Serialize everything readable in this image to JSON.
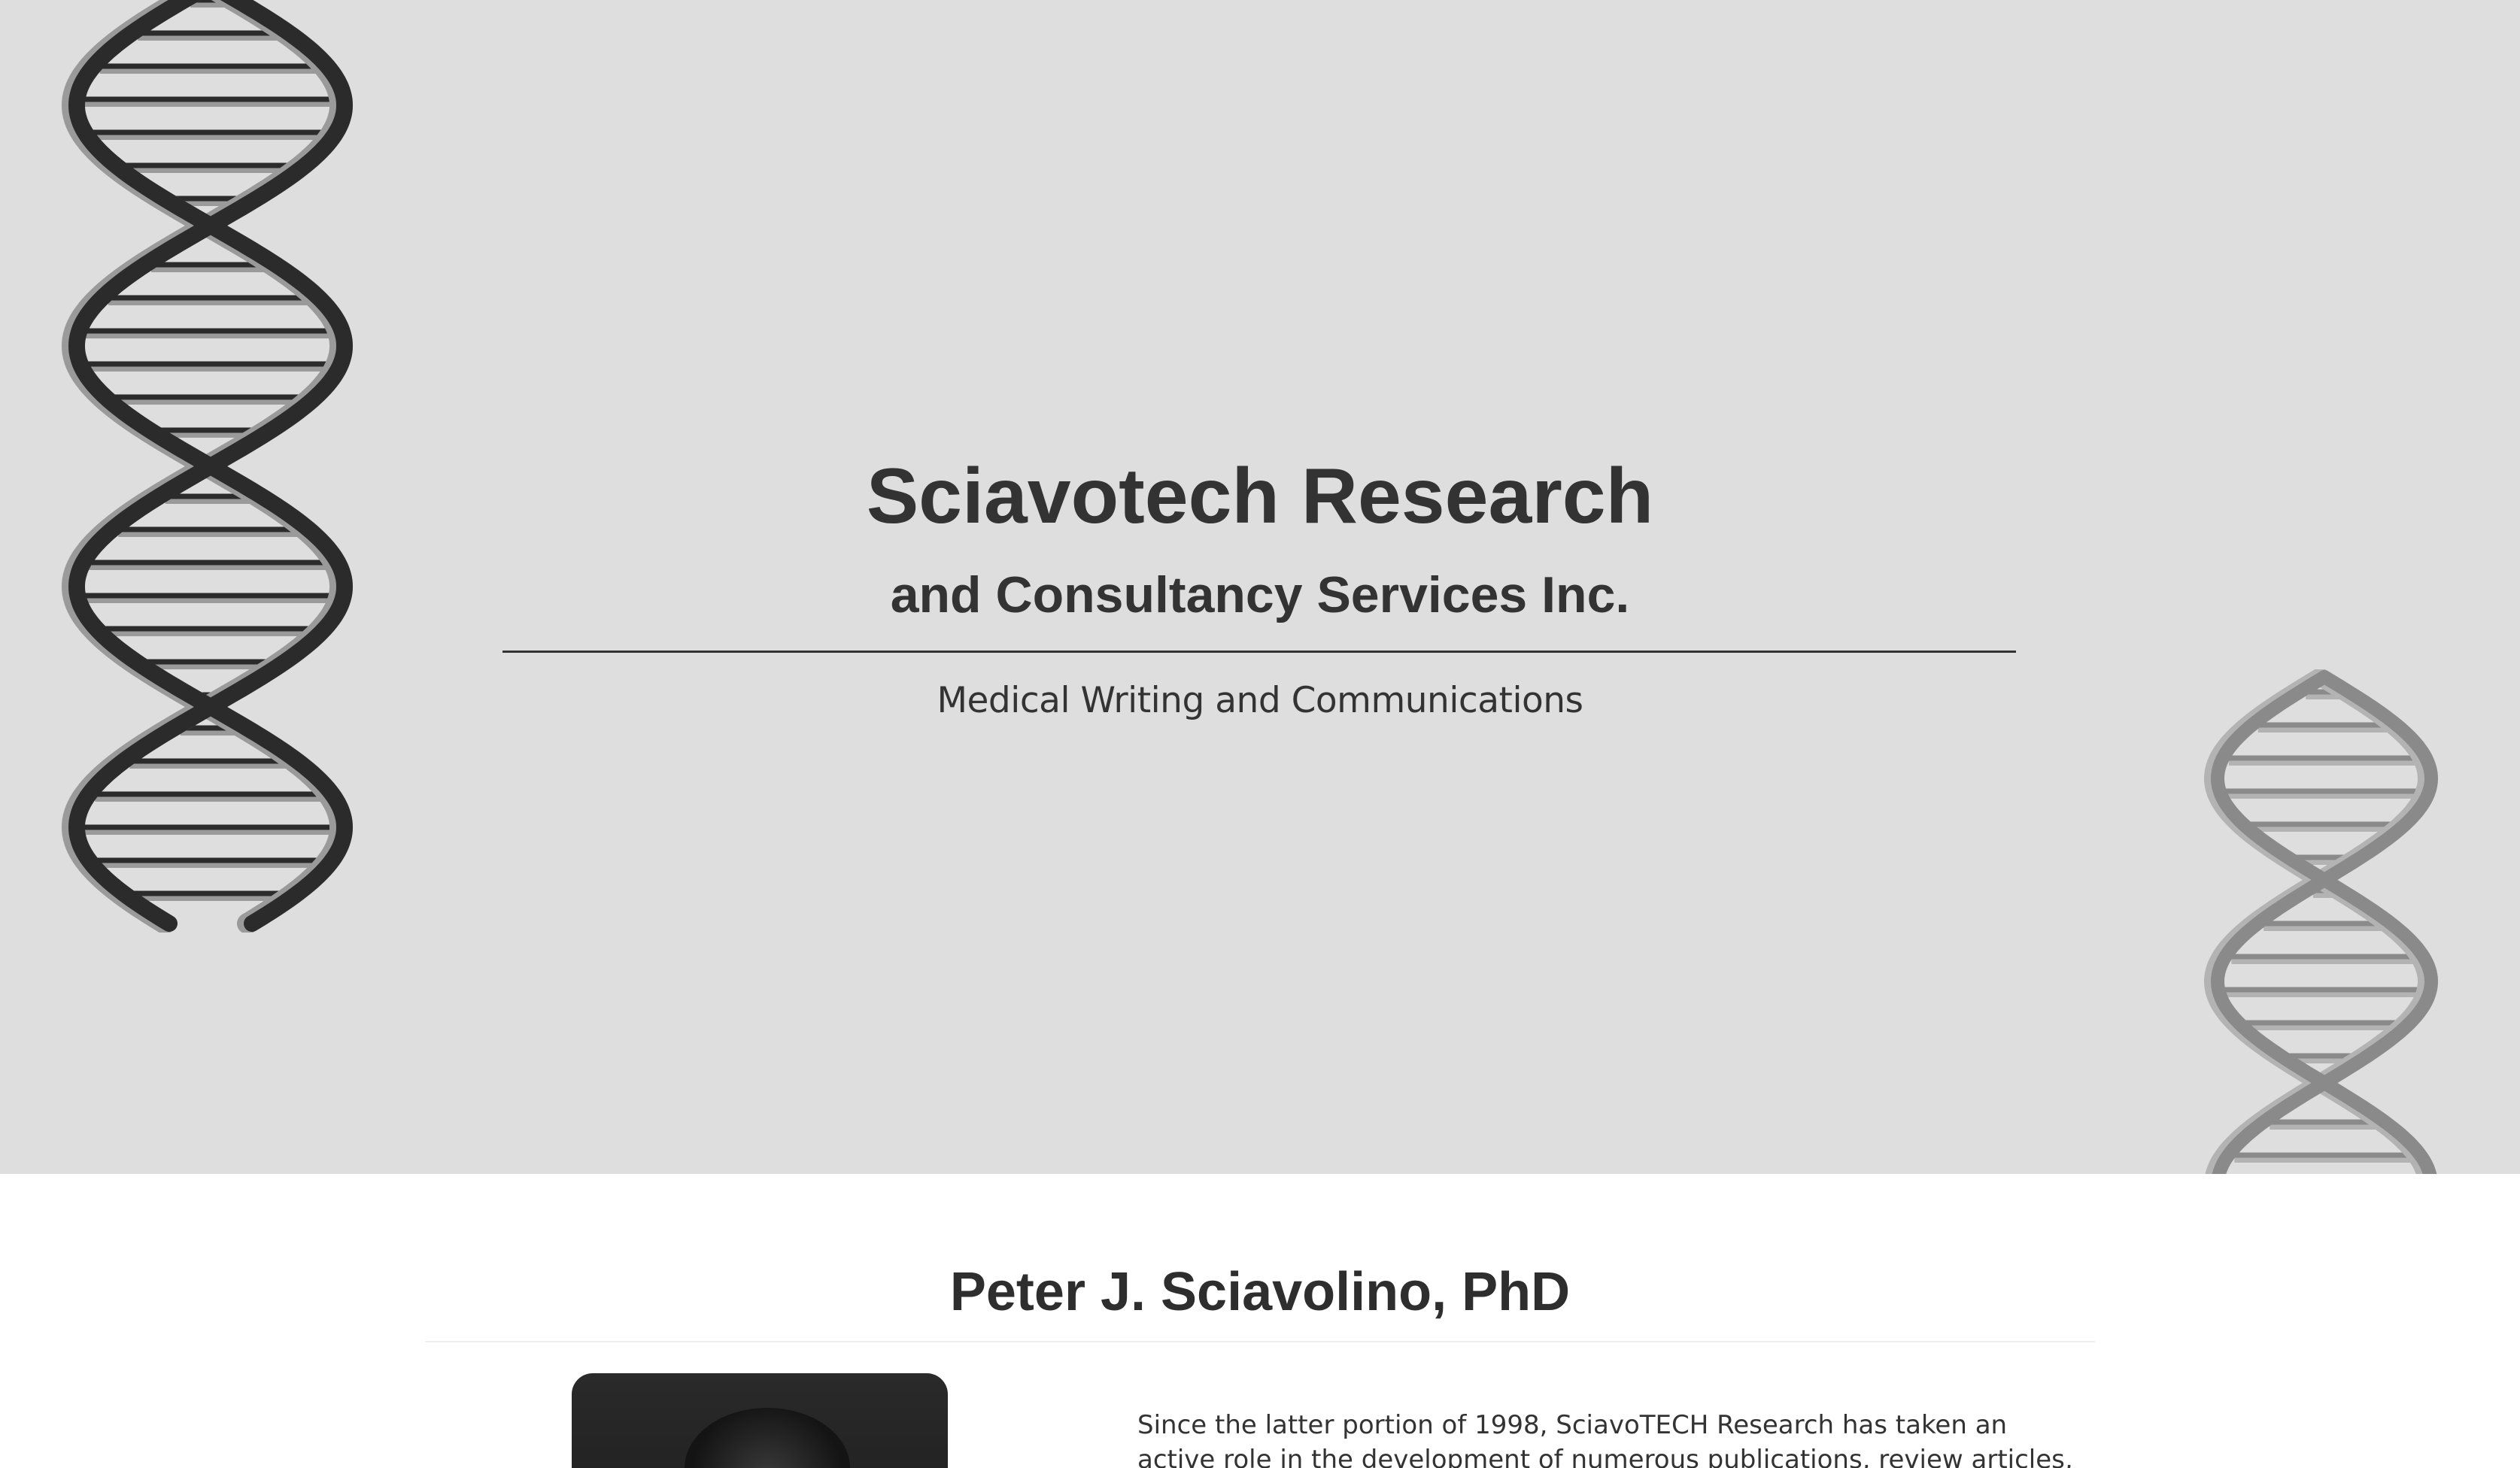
{
  "hero": {
    "title": "Sciavotech Research",
    "subtitle": "and Consultancy Services Inc.",
    "tagline": "Medical Writing and Communications"
  },
  "profile": {
    "name": "Peter J. Sciavolino, PhD",
    "bio": "Since the latter portion of 1998, SciavoTECH Research has taken an active role in the development of numerous publications, review articles, primary manuscripts,"
  },
  "colors": {
    "hero_background": "#dedede",
    "page_background": "#ffffff",
    "text": "#333333",
    "helix_dark": "#2b2b2b",
    "helix_light": "#9a9a9a",
    "helix_right": "#8a8a8a"
  },
  "icons": {
    "left_decoration": "dna-helix-icon",
    "right_decoration": "dna-helix-icon"
  }
}
